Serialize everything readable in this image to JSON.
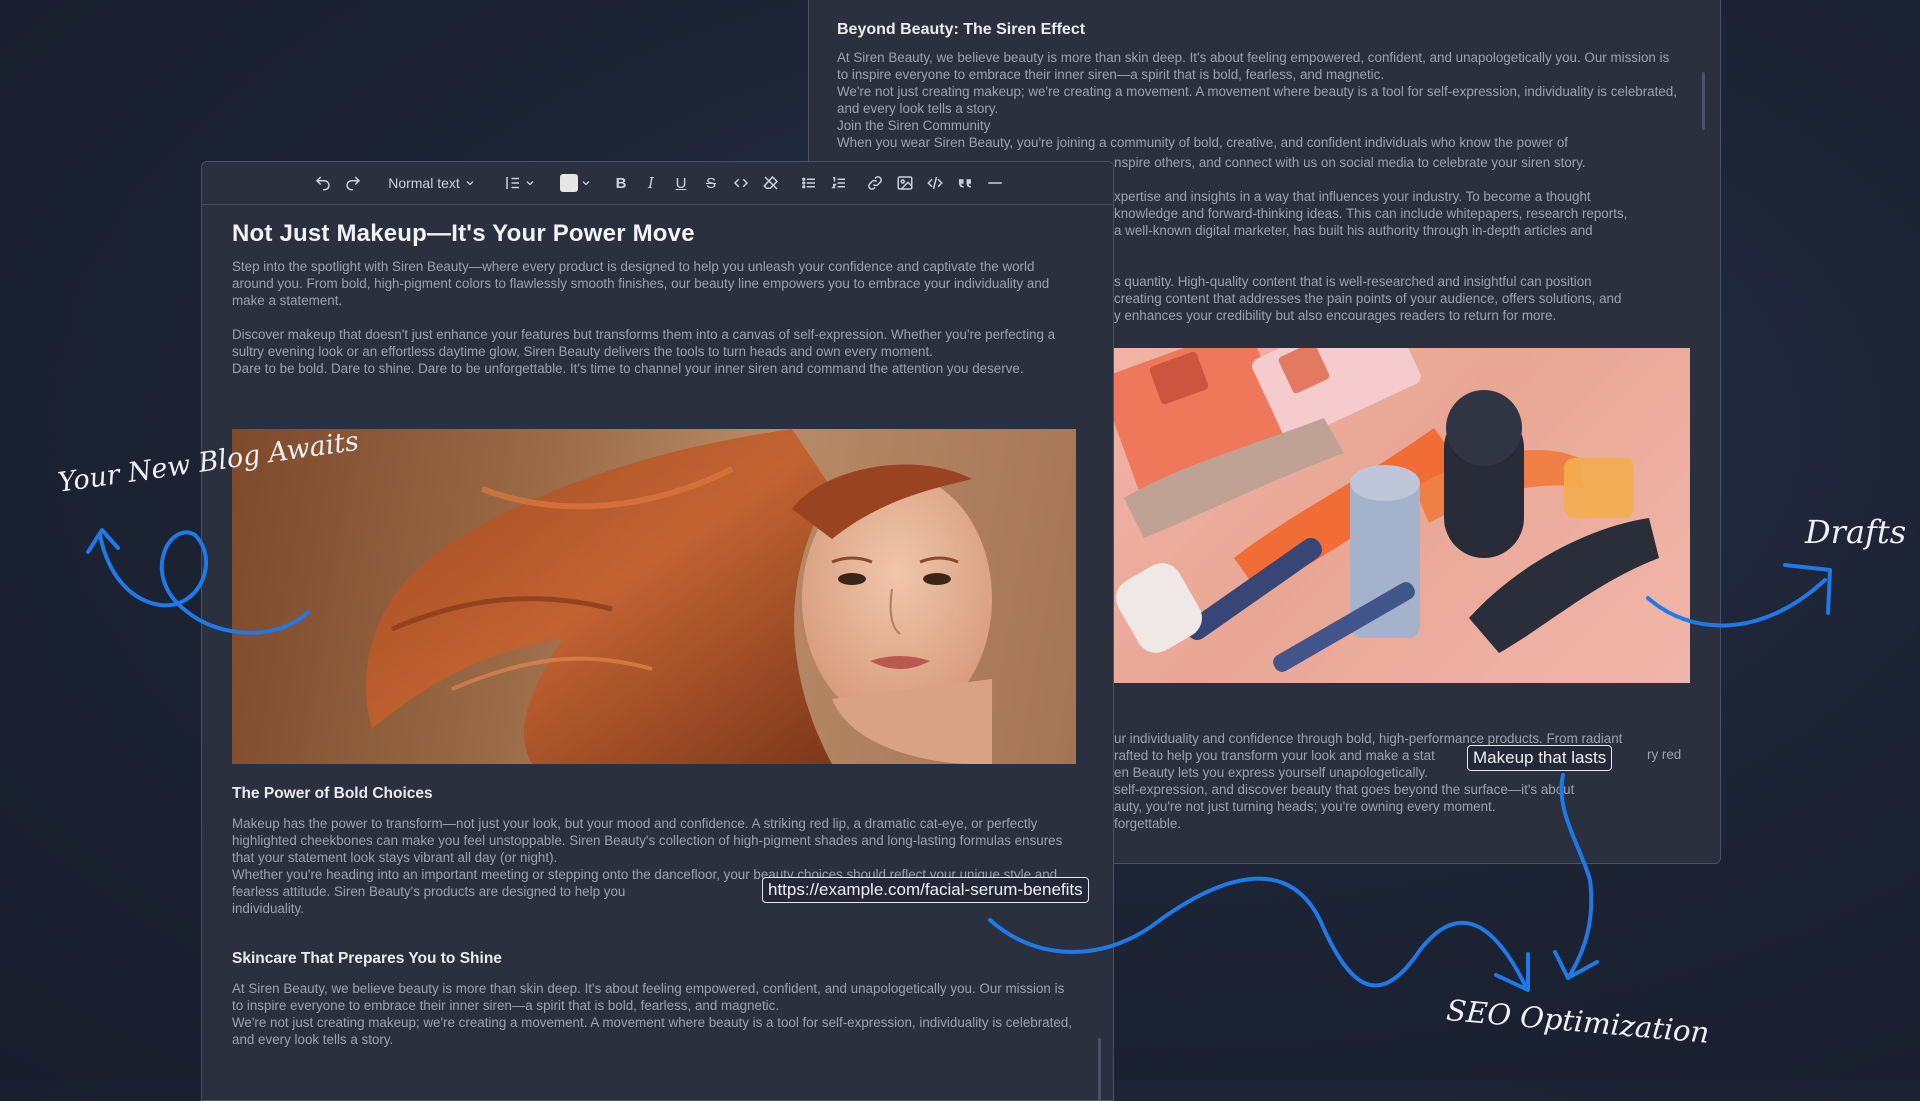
{
  "back_panel": {
    "heading": "Beyond Beauty: The Siren Effect",
    "paragraphs": [
      "At Siren Beauty, we believe beauty is more than skin deep. It's about feeling empowered, confident, and unapologetically you. Our mission is to inspire everyone to embrace their inner siren—a spirit that is bold, fearless, and magnetic.",
      "We're not just creating makeup; we're creating a movement. A movement where beauty is a tool for self-expression, individuality is celebrated, and every look tells a story.",
      "Join the Siren Community",
      "When you wear Siren Beauty, you're joining a community of bold, creative, and confident individuals who know the power of"
    ],
    "partial_line_1": "nspire others, and connect with us on social media to celebrate your siren story.",
    "partial_block_1": [
      "xpertise and insights in a way that influences your industry. To become a thought",
      "knowledge and forward-thinking ideas. This can include whitepapers, research reports,",
      "a well-known digital marketer, has built his authority through in-depth articles and"
    ],
    "partial_block_2": [
      "s quantity. High-quality content that is well-researched and insightful can position",
      "creating content that addresses the pain points of your audience, offers solutions, and",
      "y enhances your credibility but also encourages readers to return for more."
    ],
    "partial_block_3": [
      "ur individuality and confidence through bold, high-performance products. From radiant",
      "rafted to help you transform your look and make a stat",
      "en Beauty lets you express yourself unapologetically.",
      "self-expression, and discover beauty that goes beyond the surface—it's about",
      "auty, you're not just turning heads; you're owning every moment.",
      "forgettable."
    ],
    "partial_line_ry": "ry red"
  },
  "toolbar": {
    "text_style": "Normal text",
    "colors": {
      "swatch": "#e6e6e6"
    }
  },
  "editor": {
    "title": "Not Just Makeup—It's Your Power Move",
    "intro": [
      "Step into the spotlight with Siren Beauty—where every product is designed to help you unleash your confidence and captivate the world around you. From bold, high-pigment colors to flawlessly smooth finishes, our beauty line empowers you to embrace your individuality and make a statement."
    ],
    "intro2": [
      "Discover makeup that doesn't just enhance your features but transforms them into a canvas of self-expression. Whether you're perfecting a sultry evening look or an effortless daytime glow, Siren Beauty delivers the tools to turn heads and own every moment.",
      "Dare to be bold. Dare to shine. Dare to be unforgettable. It's time to channel your inner siren and command the attention you deserve."
    ],
    "h2_bold": "The Power of Bold Choices",
    "bold_paragraphs": [
      "Makeup has the power to transform—not just your look, but your mood and confidence. A striking red lip, a dramatic cat-eye, or perfectly highlighted cheekbones can make you feel unstoppable. Siren Beauty's collection of high-pigment shades and long-lasting formulas ensures that your statement look stays vibrant all day (or night).",
      "Whether you're heading into an important meeting or stepping onto the dancefloor, your beauty choices should reflect your unique style and fearless attitude. Siren Beauty's products are designed to help you",
      "individuality."
    ],
    "h2_skin": "Skincare That Prepares You to Shine",
    "skin_paragraphs": [
      "At Siren Beauty, we believe beauty is more than skin deep. It's about feeling empowered, confident, and unapologetically you. Our mission is to inspire everyone to embrace their inner siren—a spirit that is bold, fearless, and magnetic.",
      "We're not just creating makeup; we're creating a movement. A movement where beauty is a tool for self-expression, individuality is celebrated, and every look tells a story."
    ]
  },
  "annotations": {
    "blog": "Your New Blog Awaits",
    "drafts": "Drafts",
    "seo": "SEO Optimization",
    "url_tag": "https://example.com/facial-serum-benefits",
    "lasts_tag": "Makeup that lasts",
    "arrow_color": "#1f7ae8"
  }
}
